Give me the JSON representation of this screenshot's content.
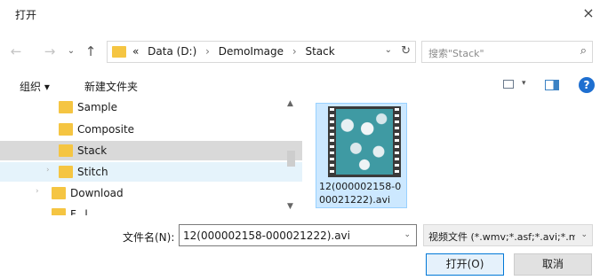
{
  "window": {
    "title": "打开",
    "close_glyph": "×"
  },
  "nav": {
    "back_glyph": "←",
    "forward_glyph": "→",
    "recent_glyph": "⌄",
    "up_glyph": "↑"
  },
  "address": {
    "overflow": "«",
    "crumbs": [
      "Data (D:)",
      "DemoImage",
      "Stack"
    ],
    "separator": "›",
    "dropdown_glyph": "⌄",
    "refresh_glyph": "↻"
  },
  "search": {
    "placeholder": "搜索\"Stack\"",
    "icon_glyph": "⌕"
  },
  "toolbar": {
    "organize": "组织 ▾",
    "new_folder": "新建文件夹",
    "view_dd": "▾",
    "help": "?"
  },
  "tree": [
    {
      "label": "Sample",
      "state": "normal",
      "expander": ""
    },
    {
      "label": "Composite",
      "state": "normal",
      "expander": ""
    },
    {
      "label": "Stack",
      "state": "selected",
      "expander": ""
    },
    {
      "label": "Stitch",
      "state": "hover",
      "expander": "›"
    },
    {
      "label": "Download",
      "state": "normal",
      "expander": "›"
    },
    {
      "label": "F...l",
      "state": "normal",
      "expander": ""
    }
  ],
  "scroll": {
    "up": "▲",
    "down": "▼"
  },
  "files": [
    {
      "name": "12(000002158-000021222).avi"
    }
  ],
  "filename": {
    "label": "文件名(N):",
    "value": "12(000002158-000021222).avi",
    "dd": "⌄"
  },
  "filetype": {
    "value": "视频文件 (*.wmv;*.asf;*.avi;*.m",
    "dd": "⌄"
  },
  "buttons": {
    "open": "打开(O)",
    "cancel": "取消"
  }
}
